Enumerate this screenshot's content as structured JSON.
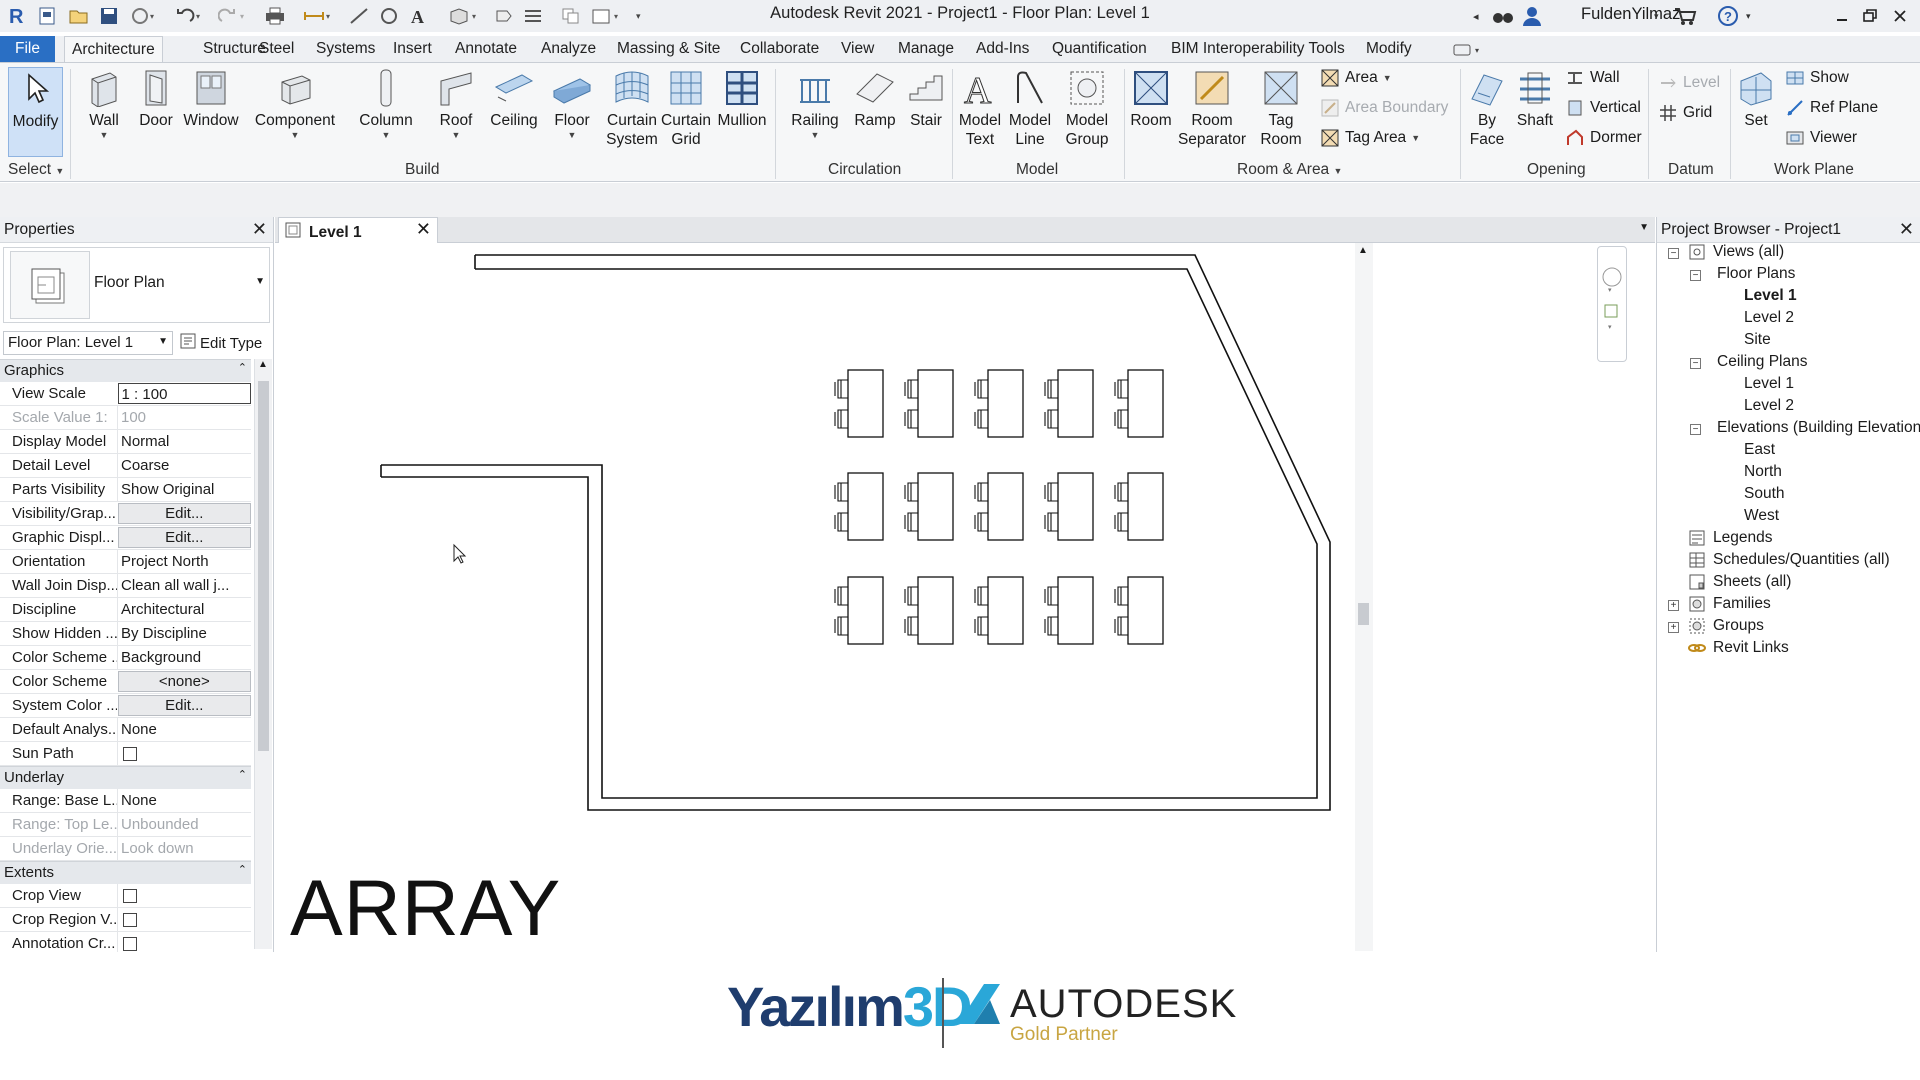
{
  "window": {
    "title": "Autodesk Revit 2021 - Project1 - Floor Plan: Level 1",
    "user": "FuldenYilmaz"
  },
  "ribbon": {
    "tabs": [
      "File",
      "Architecture",
      "Structure",
      "Steel",
      "Systems",
      "Insert",
      "Annotate",
      "Analyze",
      "Massing & Site",
      "Collaborate",
      "View",
      "Manage",
      "Add-Ins",
      "Quantification",
      "BIM Interoperability Tools",
      "Modify"
    ],
    "active_tab": "Architecture",
    "select": {
      "modify": "Modify",
      "panel": "Select"
    },
    "build": {
      "panel": "Build",
      "wall": "Wall",
      "door": "Door",
      "window": "Window",
      "component": "Component",
      "column": "Column",
      "roof": "Roof",
      "ceiling": "Ceiling",
      "floor": "Floor",
      "curtain_system_1": "Curtain",
      "curtain_system_2": "System",
      "curtain_grid_1": "Curtain",
      "curtain_grid_2": "Grid",
      "mullion": "Mullion"
    },
    "circulation": {
      "panel": "Circulation",
      "railing": "Railing",
      "ramp": "Ramp",
      "stair": "Stair"
    },
    "model": {
      "panel": "Model",
      "model_text_1": "Model",
      "model_text_2": "Text",
      "model_line_1": "Model",
      "model_line_2": "Line",
      "model_group_1": "Model",
      "model_group_2": "Group"
    },
    "room_area": {
      "panel": "Room & Area",
      "room": "Room",
      "room_separator_1": "Room",
      "room_separator_2": "Separator",
      "tag_room_1": "Tag",
      "tag_room_2": "Room",
      "area": "Area",
      "area_boundary": "Area  Boundary",
      "tag_area": "Tag  Area"
    },
    "opening": {
      "panel": "Opening",
      "by_face_1": "By",
      "by_face_2": "Face",
      "shaft": "Shaft",
      "wall": "Wall",
      "vertical": "Vertical",
      "dormer": "Dormer"
    },
    "datum": {
      "panel": "Datum",
      "level": "Level",
      "grid": "Grid"
    },
    "work_plane": {
      "panel": "Work Plane",
      "set": "Set",
      "show": "Show",
      "ref_plane": "Ref  Plane",
      "viewer": "Viewer"
    }
  },
  "properties": {
    "title": "Properties",
    "type_name": "Floor Plan",
    "instance_filter": "Floor Plan: Level 1",
    "edit_type": "Edit Type",
    "groups": {
      "graphics": "Graphics",
      "underlay": "Underlay",
      "extents": "Extents"
    },
    "rows": {
      "view_scale": {
        "k": "View Scale",
        "v": "1 : 100"
      },
      "scale_value": {
        "k": "Scale Value    1:",
        "v": "100"
      },
      "display_model": {
        "k": "Display Model",
        "v": "Normal"
      },
      "detail_level": {
        "k": "Detail Level",
        "v": "Coarse"
      },
      "parts_visibility": {
        "k": "Parts Visibility",
        "v": "Show Original"
      },
      "visibility_graphics": {
        "k": "Visibility/Grap...",
        "v": "Edit..."
      },
      "graphic_display": {
        "k": "Graphic Displ...",
        "v": "Edit..."
      },
      "orientation": {
        "k": "Orientation",
        "v": "Project North"
      },
      "wall_join": {
        "k": "Wall Join Disp...",
        "v": "Clean all wall j..."
      },
      "discipline": {
        "k": "Discipline",
        "v": "Architectural"
      },
      "show_hidden": {
        "k": "Show Hidden ...",
        "v": "By Discipline"
      },
      "color_scheme_loc": {
        "k": "Color Scheme ...",
        "v": "Background"
      },
      "color_scheme": {
        "k": "Color Scheme",
        "v": "<none>"
      },
      "system_color": {
        "k": "System Color ...",
        "v": "Edit..."
      },
      "default_analysis": {
        "k": "Default Analys...",
        "v": "None"
      },
      "sun_path": {
        "k": "Sun Path",
        "v": ""
      },
      "range_base": {
        "k": "Range: Base L...",
        "v": "None"
      },
      "range_top": {
        "k": "Range: Top Le...",
        "v": "Unbounded"
      },
      "underlay_orient": {
        "k": "Underlay Orie...",
        "v": "Look down"
      },
      "crop_view": {
        "k": "Crop View",
        "v": ""
      },
      "crop_region": {
        "k": "Crop Region V...",
        "v": ""
      },
      "annotation_crop": {
        "k": "Annotation Cr...",
        "v": ""
      }
    }
  },
  "view": {
    "tab_title": "Level 1",
    "caption": "ARRAY"
  },
  "project_browser": {
    "title": "Project Browser - Project1",
    "items": {
      "views_all": "Views (all)",
      "floor_plans": "Floor Plans",
      "fp_level1": "Level 1",
      "fp_level2": "Level 2",
      "fp_site": "Site",
      "ceiling_plans": "Ceiling Plans",
      "cp_level1": "Level 1",
      "cp_level2": "Level 2",
      "elevations": "Elevations (Building Elevation",
      "east": "East",
      "north": "North",
      "south": "South",
      "west": "West",
      "legends": "Legends",
      "schedules": "Schedules/Quantities (all)",
      "sheets": "Sheets (all)",
      "families": "Families",
      "groups": "Groups",
      "revit_links": "Revit Links"
    }
  },
  "footer": {
    "logo_left": "Yazılım",
    "logo_left_3d": "3D",
    "logo_right": "AUTODESK",
    "logo_right_sub": "Gold Partner"
  },
  "colors": {
    "accent": "#2a6fc4",
    "brand_navy": "#1f3d6e",
    "brand_cyan": "#2aa7d8",
    "gold": "#c8a542"
  }
}
